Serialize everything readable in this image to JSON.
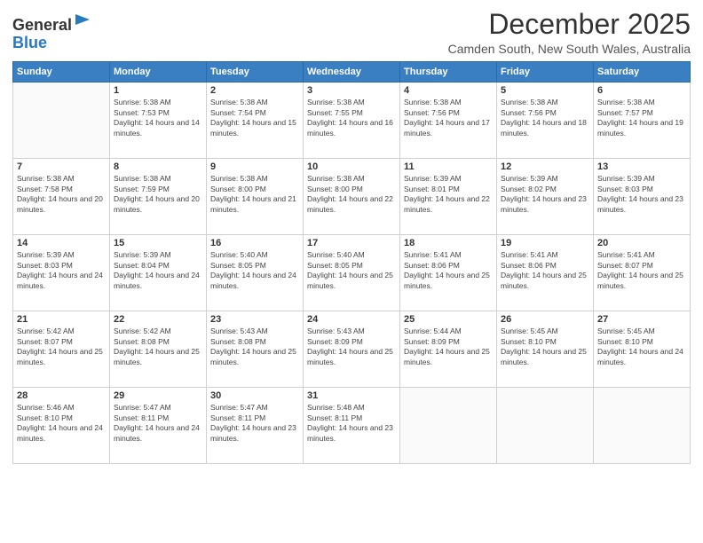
{
  "logo": {
    "general": "General",
    "blue": "Blue"
  },
  "header": {
    "month": "December 2025",
    "location": "Camden South, New South Wales, Australia"
  },
  "weekdays": [
    "Sunday",
    "Monday",
    "Tuesday",
    "Wednesday",
    "Thursday",
    "Friday",
    "Saturday"
  ],
  "weeks": [
    [
      {
        "day": "",
        "sunrise": "",
        "sunset": "",
        "daylight": ""
      },
      {
        "day": "1",
        "sunrise": "Sunrise: 5:38 AM",
        "sunset": "Sunset: 7:53 PM",
        "daylight": "Daylight: 14 hours and 14 minutes."
      },
      {
        "day": "2",
        "sunrise": "Sunrise: 5:38 AM",
        "sunset": "Sunset: 7:54 PM",
        "daylight": "Daylight: 14 hours and 15 minutes."
      },
      {
        "day": "3",
        "sunrise": "Sunrise: 5:38 AM",
        "sunset": "Sunset: 7:55 PM",
        "daylight": "Daylight: 14 hours and 16 minutes."
      },
      {
        "day": "4",
        "sunrise": "Sunrise: 5:38 AM",
        "sunset": "Sunset: 7:56 PM",
        "daylight": "Daylight: 14 hours and 17 minutes."
      },
      {
        "day": "5",
        "sunrise": "Sunrise: 5:38 AM",
        "sunset": "Sunset: 7:56 PM",
        "daylight": "Daylight: 14 hours and 18 minutes."
      },
      {
        "day": "6",
        "sunrise": "Sunrise: 5:38 AM",
        "sunset": "Sunset: 7:57 PM",
        "daylight": "Daylight: 14 hours and 19 minutes."
      }
    ],
    [
      {
        "day": "7",
        "sunrise": "Sunrise: 5:38 AM",
        "sunset": "Sunset: 7:58 PM",
        "daylight": "Daylight: 14 hours and 20 minutes."
      },
      {
        "day": "8",
        "sunrise": "Sunrise: 5:38 AM",
        "sunset": "Sunset: 7:59 PM",
        "daylight": "Daylight: 14 hours and 20 minutes."
      },
      {
        "day": "9",
        "sunrise": "Sunrise: 5:38 AM",
        "sunset": "Sunset: 8:00 PM",
        "daylight": "Daylight: 14 hours and 21 minutes."
      },
      {
        "day": "10",
        "sunrise": "Sunrise: 5:38 AM",
        "sunset": "Sunset: 8:00 PM",
        "daylight": "Daylight: 14 hours and 22 minutes."
      },
      {
        "day": "11",
        "sunrise": "Sunrise: 5:39 AM",
        "sunset": "Sunset: 8:01 PM",
        "daylight": "Daylight: 14 hours and 22 minutes."
      },
      {
        "day": "12",
        "sunrise": "Sunrise: 5:39 AM",
        "sunset": "Sunset: 8:02 PM",
        "daylight": "Daylight: 14 hours and 23 minutes."
      },
      {
        "day": "13",
        "sunrise": "Sunrise: 5:39 AM",
        "sunset": "Sunset: 8:03 PM",
        "daylight": "Daylight: 14 hours and 23 minutes."
      }
    ],
    [
      {
        "day": "14",
        "sunrise": "Sunrise: 5:39 AM",
        "sunset": "Sunset: 8:03 PM",
        "daylight": "Daylight: 14 hours and 24 minutes."
      },
      {
        "day": "15",
        "sunrise": "Sunrise: 5:39 AM",
        "sunset": "Sunset: 8:04 PM",
        "daylight": "Daylight: 14 hours and 24 minutes."
      },
      {
        "day": "16",
        "sunrise": "Sunrise: 5:40 AM",
        "sunset": "Sunset: 8:05 PM",
        "daylight": "Daylight: 14 hours and 24 minutes."
      },
      {
        "day": "17",
        "sunrise": "Sunrise: 5:40 AM",
        "sunset": "Sunset: 8:05 PM",
        "daylight": "Daylight: 14 hours and 25 minutes."
      },
      {
        "day": "18",
        "sunrise": "Sunrise: 5:41 AM",
        "sunset": "Sunset: 8:06 PM",
        "daylight": "Daylight: 14 hours and 25 minutes."
      },
      {
        "day": "19",
        "sunrise": "Sunrise: 5:41 AM",
        "sunset": "Sunset: 8:06 PM",
        "daylight": "Daylight: 14 hours and 25 minutes."
      },
      {
        "day": "20",
        "sunrise": "Sunrise: 5:41 AM",
        "sunset": "Sunset: 8:07 PM",
        "daylight": "Daylight: 14 hours and 25 minutes."
      }
    ],
    [
      {
        "day": "21",
        "sunrise": "Sunrise: 5:42 AM",
        "sunset": "Sunset: 8:07 PM",
        "daylight": "Daylight: 14 hours and 25 minutes."
      },
      {
        "day": "22",
        "sunrise": "Sunrise: 5:42 AM",
        "sunset": "Sunset: 8:08 PM",
        "daylight": "Daylight: 14 hours and 25 minutes."
      },
      {
        "day": "23",
        "sunrise": "Sunrise: 5:43 AM",
        "sunset": "Sunset: 8:08 PM",
        "daylight": "Daylight: 14 hours and 25 minutes."
      },
      {
        "day": "24",
        "sunrise": "Sunrise: 5:43 AM",
        "sunset": "Sunset: 8:09 PM",
        "daylight": "Daylight: 14 hours and 25 minutes."
      },
      {
        "day": "25",
        "sunrise": "Sunrise: 5:44 AM",
        "sunset": "Sunset: 8:09 PM",
        "daylight": "Daylight: 14 hours and 25 minutes."
      },
      {
        "day": "26",
        "sunrise": "Sunrise: 5:45 AM",
        "sunset": "Sunset: 8:10 PM",
        "daylight": "Daylight: 14 hours and 25 minutes."
      },
      {
        "day": "27",
        "sunrise": "Sunrise: 5:45 AM",
        "sunset": "Sunset: 8:10 PM",
        "daylight": "Daylight: 14 hours and 24 minutes."
      }
    ],
    [
      {
        "day": "28",
        "sunrise": "Sunrise: 5:46 AM",
        "sunset": "Sunset: 8:10 PM",
        "daylight": "Daylight: 14 hours and 24 minutes."
      },
      {
        "day": "29",
        "sunrise": "Sunrise: 5:47 AM",
        "sunset": "Sunset: 8:11 PM",
        "daylight": "Daylight: 14 hours and 24 minutes."
      },
      {
        "day": "30",
        "sunrise": "Sunrise: 5:47 AM",
        "sunset": "Sunset: 8:11 PM",
        "daylight": "Daylight: 14 hours and 23 minutes."
      },
      {
        "day": "31",
        "sunrise": "Sunrise: 5:48 AM",
        "sunset": "Sunset: 8:11 PM",
        "daylight": "Daylight: 14 hours and 23 minutes."
      },
      {
        "day": "",
        "sunrise": "",
        "sunset": "",
        "daylight": ""
      },
      {
        "day": "",
        "sunrise": "",
        "sunset": "",
        "daylight": ""
      },
      {
        "day": "",
        "sunrise": "",
        "sunset": "",
        "daylight": ""
      }
    ]
  ]
}
